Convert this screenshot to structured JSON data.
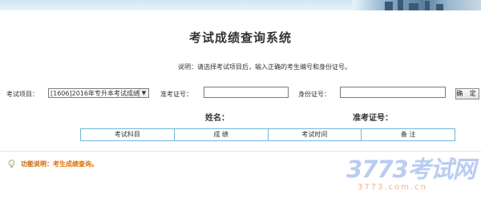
{
  "header": {
    "title": "考试成绩查询系统"
  },
  "notice": "说明：请选择考试项目后，输入正确的考生编号和身份证号。",
  "form": {
    "exam_label": "考试项目：",
    "exam_value": "[1606]2016年专升本考试成绩",
    "candidate_label": "准考证号：",
    "candidate_value": "",
    "id_label": "身份证号：",
    "id_value": "",
    "submit_label": "确 定"
  },
  "result": {
    "name_label": "姓名：",
    "ticket_label": "准考证号：",
    "columns": [
      "考试科目",
      "成 绩",
      "考试时间",
      "备 注"
    ]
  },
  "footer": {
    "label": "功能说明：",
    "desc": "考生成绩查询。"
  },
  "watermark": {
    "brand": "3773考试网",
    "url": "3773.com.cn"
  },
  "colors": {
    "accent": "#cc6600",
    "table_border": "#6fb6d9"
  }
}
